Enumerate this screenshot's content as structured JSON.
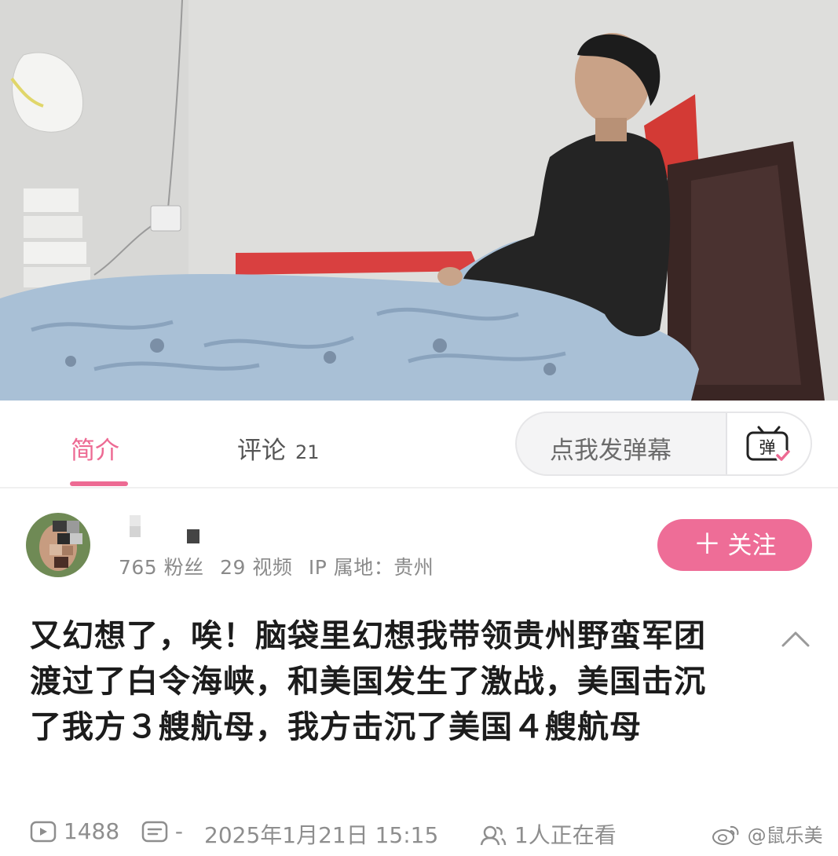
{
  "tabs": {
    "intro_label": "简介",
    "comments_label": "评论",
    "comments_count": "21",
    "active": "简介",
    "accent_color": "#ed6a93"
  },
  "danmaku": {
    "placeholder": "点我发弹幕",
    "icon_glyph": "弹",
    "icon": "danmaku-toggle-icon"
  },
  "author": {
    "fans": "765 粉丝",
    "videos": "29 视频",
    "ip_location": "IP 属地：贵州",
    "follow_label": "关注",
    "follow_icon": "plus-icon",
    "follow_color": "#ee6d97"
  },
  "description": {
    "text": "又幻想了，唉！脑袋里幻想我带领贵州野蛮军团渡过了白令海峡，和美国发生了激战，美国击沉了我方３艘航母，我方击沉了美国４艘航母",
    "collapse_icon": "chevron-up-icon"
  },
  "meta": {
    "play_count": "1488",
    "danmaku_count": "-",
    "date_time": "2025年1月21日 15:15",
    "watching": "1人正在看"
  },
  "watermark": "@鼠乐美"
}
